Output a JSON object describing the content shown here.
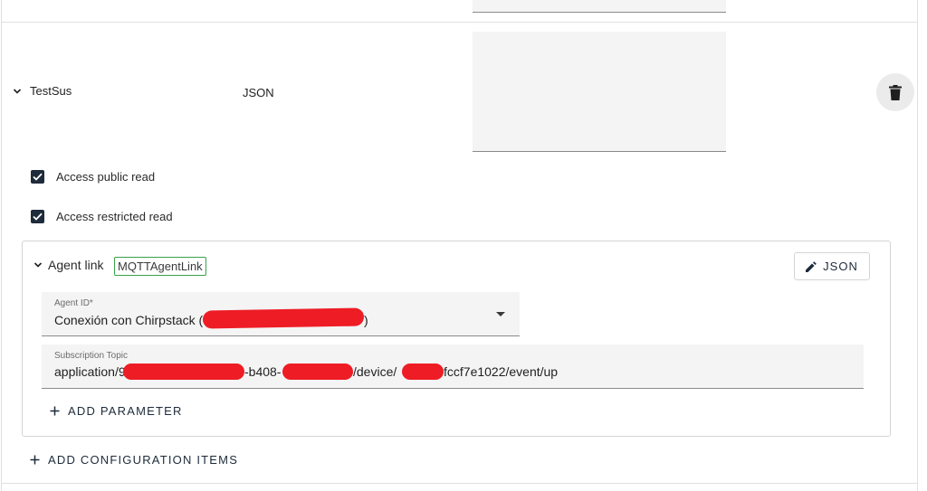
{
  "item": {
    "name": "TestSus",
    "type": "JSON"
  },
  "checkboxes": [
    {
      "label": "Access public read",
      "checked": true
    },
    {
      "label": "Access restricted read",
      "checked": true
    }
  ],
  "agent_link": {
    "title": "Agent link",
    "badge": "MQTTAgentLink",
    "json_button": "JSON",
    "agent_id": {
      "label": "Agent ID*",
      "value_prefix": "Conexión con Chirpstack (",
      "value_suffix": ")"
    },
    "subscription_topic": {
      "label": "Subscription Topic",
      "part1": "application/9",
      "part2": "-b408-",
      "part3": "/device/",
      "part4": "fccf7e1022/event/up"
    },
    "add_parameter": "ADD PARAMETER"
  },
  "add_configuration_items": "ADD CONFIGURATION ITEMS",
  "colors": {
    "accent": "#1d2b3a",
    "badge_border": "#3aa14a",
    "redaction": "#ee1c25",
    "field_bg": "#f4f4f4"
  },
  "icons": [
    "chevron-down-icon",
    "delete-icon",
    "check-icon",
    "pencil-icon",
    "dropdown-arrow-icon",
    "plus-icon"
  ]
}
